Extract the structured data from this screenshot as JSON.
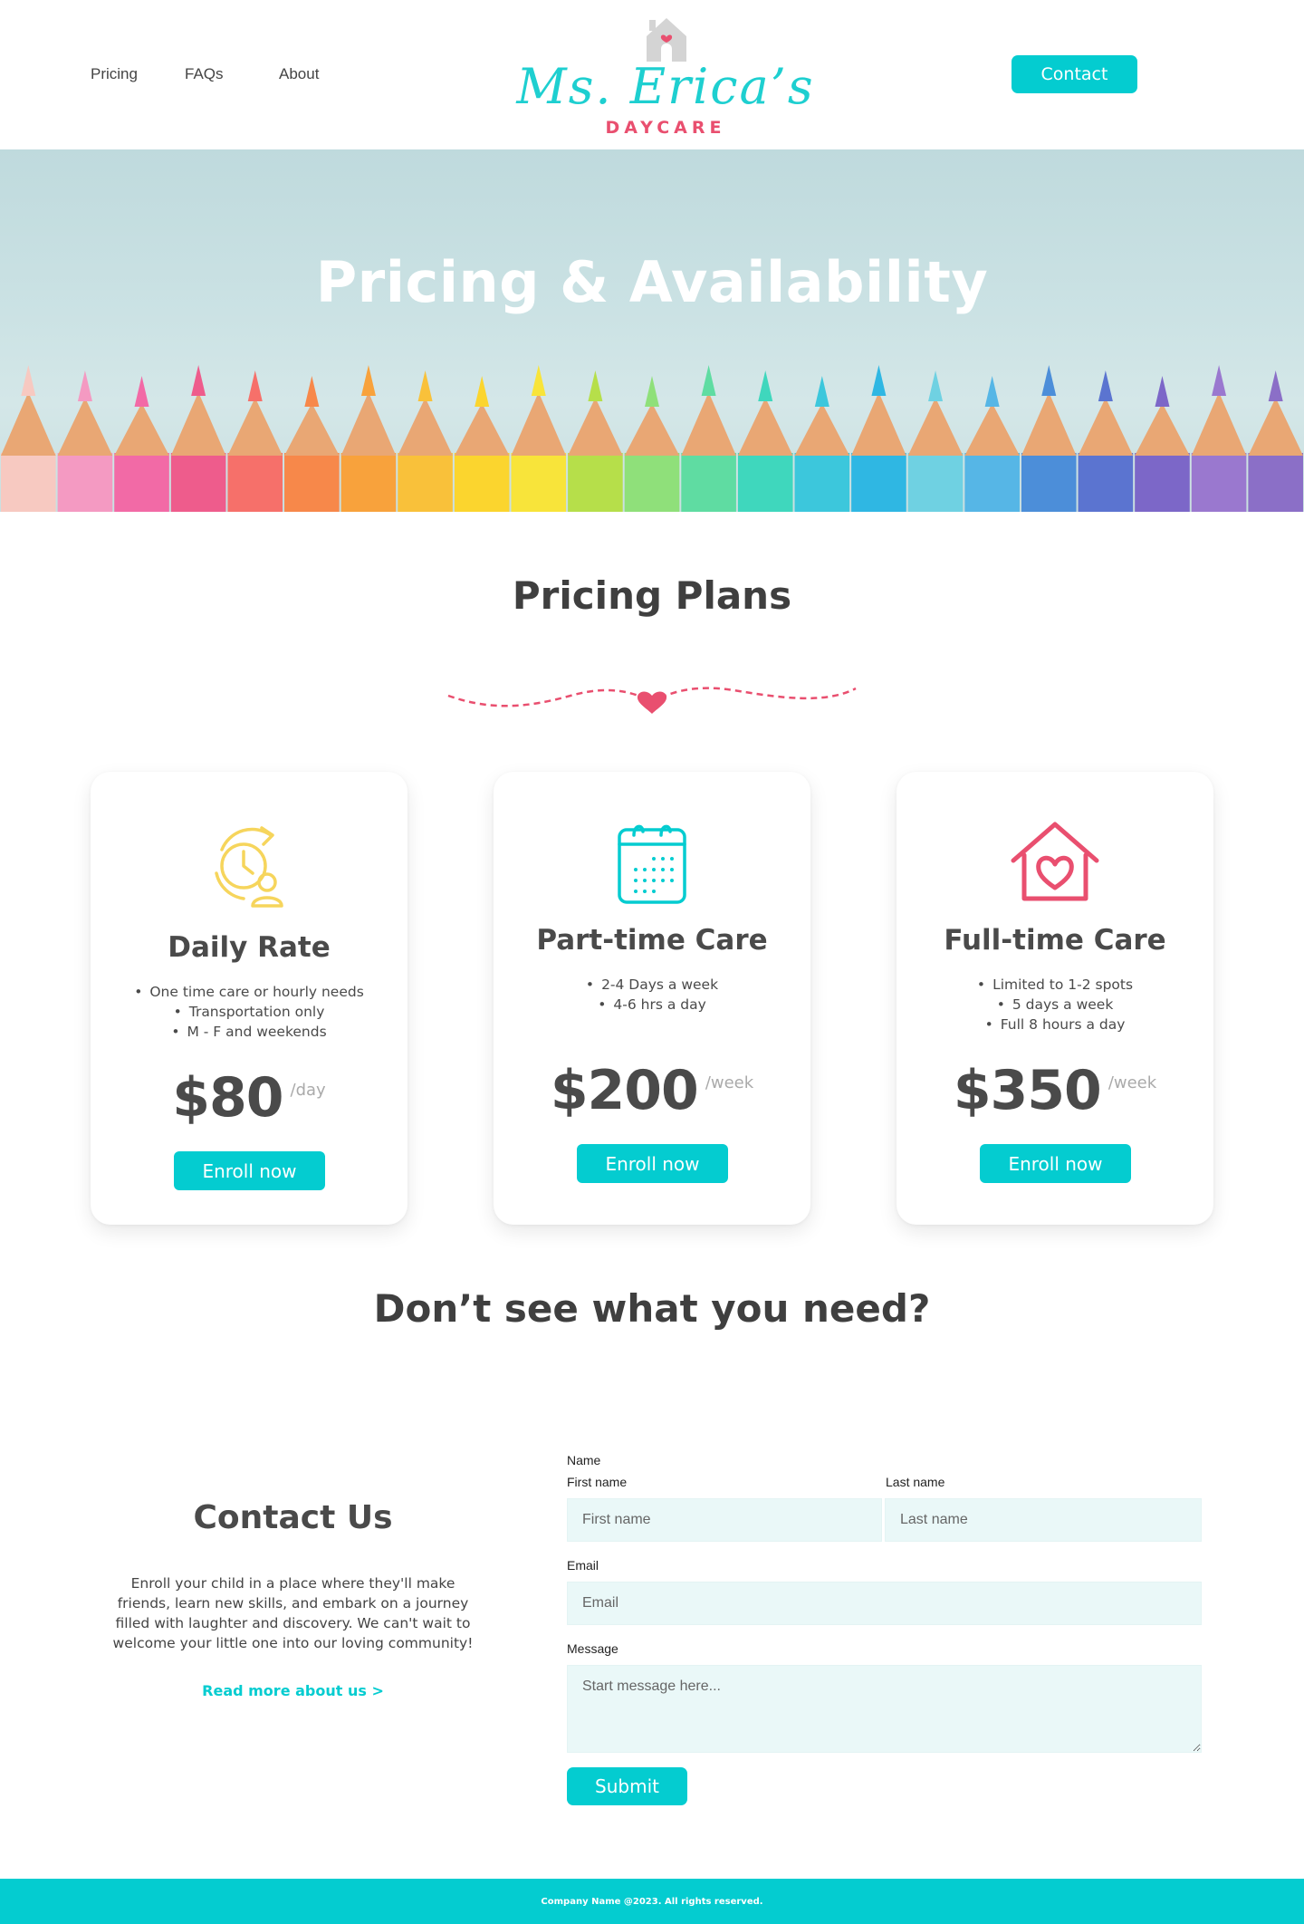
{
  "nav": {
    "links": [
      "Pricing",
      "FAQs",
      "About"
    ],
    "contact_label": "Contact"
  },
  "logo": {
    "name": "Ms. Erica’s",
    "tagline": "DAYCARE"
  },
  "hero": {
    "title": "Pricing & Availability"
  },
  "pricing": {
    "title": "Pricing Plans",
    "plans": [
      {
        "title": "Daily Rate",
        "icon": "clock-person-icon",
        "features": [
          "One time care or hourly needs",
          "Transportation only",
          "M - F and weekends"
        ],
        "price": "$80",
        "per": "/day",
        "button": "Enroll now"
      },
      {
        "title": "Part-time Care",
        "icon": "calendar-icon",
        "features": [
          "2-4 Days a week",
          "4-6 hrs a day"
        ],
        "price": "$200",
        "per": "/week",
        "button": "Enroll now"
      },
      {
        "title": "Full-time Care",
        "icon": "house-heart-icon",
        "features": [
          "Limited to 1-2 spots",
          "5 days a week",
          "Full 8 hours a day"
        ],
        "price": "$350",
        "per": "/week",
        "button": "Enroll now"
      }
    ]
  },
  "need": {
    "title": "Don’t see what you need?"
  },
  "contact": {
    "title": "Contact Us",
    "text": "Enroll your child in a place where they'll make friends, learn new skills, and embark on a journey filled with laughter and discovery. We can't wait to welcome your little one into our loving community!",
    "read_more": "Read more about us >",
    "form": {
      "name_label": "Name",
      "first_name_label": "First name",
      "last_name_label": "Last name",
      "first_name_placeholder": "First name",
      "last_name_placeholder": "Last name",
      "email_label": "Email",
      "email_placeholder": "Email",
      "message_label": "Message",
      "message_placeholder": "Start message here...",
      "submit_label": "Submit"
    }
  },
  "footer": {
    "text": "Company Name @2023. All rights reserved."
  },
  "colors": {
    "accent": "#04ccd0",
    "pink": "#e94f6f",
    "yellow": "#f6d55c",
    "text_dark": "#444444"
  }
}
